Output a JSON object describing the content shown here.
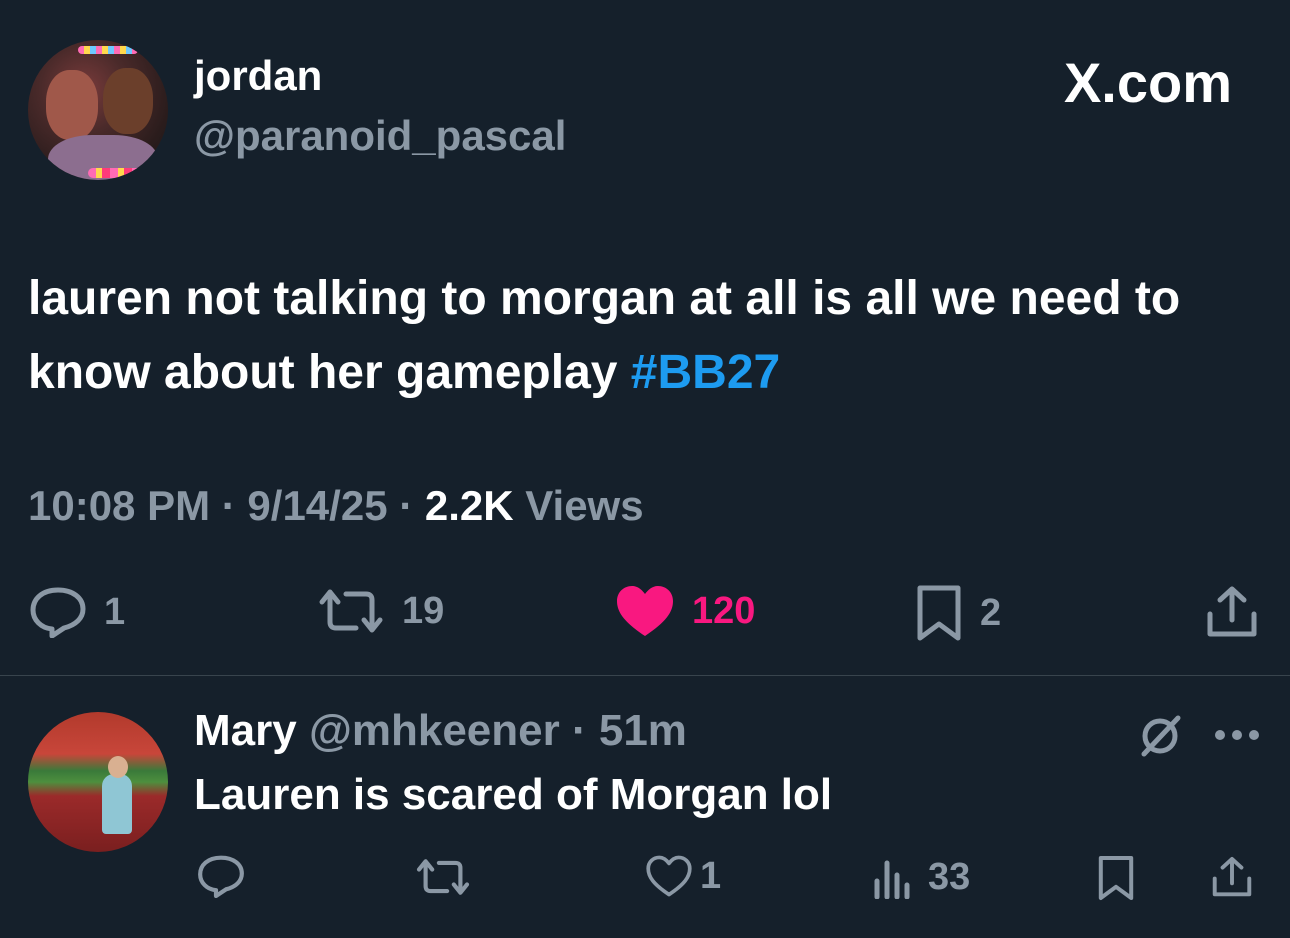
{
  "tweet": {
    "author_name": "jordan",
    "author_handle": "@paranoid_pascal",
    "site_label": "X.com",
    "text_before_hashtag": "lauren not talking to morgan at all is all we need to know about her gameplay ",
    "hashtag": "#BB27",
    "time": "10:08 PM",
    "date": "9/14/25",
    "separator": " · ",
    "views_count": "2.2K",
    "views_label": " Views",
    "actions": {
      "replies": "1",
      "retweets": "19",
      "likes": "120",
      "bookmarks": "2"
    },
    "like_color": "#f91880",
    "hashtag_color": "#1d9bf0"
  },
  "reply": {
    "author_name": "Mary",
    "author_handle": "@mhkeener",
    "time_ago": "51m",
    "separator": " · ",
    "text": "Lauren is scared of Morgan lol",
    "actions": {
      "likes": "1",
      "views": "33"
    }
  },
  "icons": {
    "reply": "speech-bubble-icon",
    "retweet": "retweet-icon",
    "like": "heart-icon",
    "bookmark": "bookmark-icon",
    "share": "share-icon",
    "views": "bar-chart-icon",
    "grok": "grok-icon",
    "more": "more-dots-icon"
  }
}
